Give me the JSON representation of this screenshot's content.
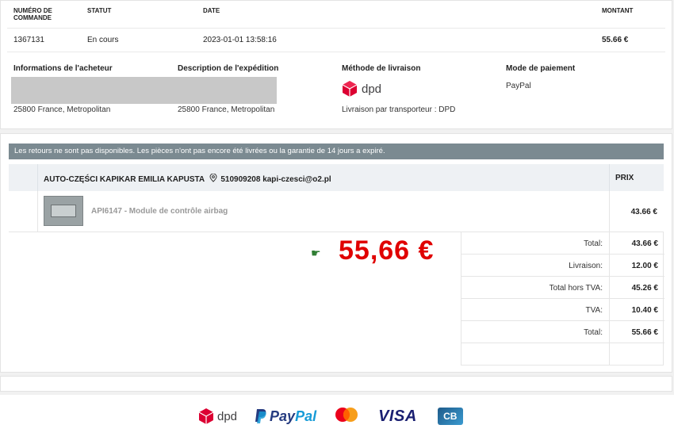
{
  "order": {
    "headers": {
      "number": "NUMÉRO DE COMMANDE",
      "status": "STATUT",
      "date": "DATE",
      "amount": "MONTANT"
    },
    "number": "1367131",
    "status": "En cours",
    "date": "2023-01-01 13:58:16",
    "amount": "55.66 €"
  },
  "buyer": {
    "title": "Informations de l'acheteur",
    "address": "25800 France, Metropolitan"
  },
  "shipping_desc": {
    "title": "Description de l'expédition",
    "address": "25800 France, Metropolitan"
  },
  "delivery": {
    "title": "Méthode de livraison",
    "logo_text": "dpd",
    "detail": "Livraison par transporteur : DPD"
  },
  "payment": {
    "title": "Mode de paiement",
    "method": "PayPal"
  },
  "notice": "Les retours ne sont pas disponibles. Les pièces n'ont pas encore été livrées ou la garantie de 14 jours a expiré.",
  "seller": {
    "name": "AUTO-CZĘŚCI KAPIKAR EMILIA KAPUSTA",
    "phone": "510909208",
    "email": "kapi-czesci@o2.pl",
    "price_header": "PRIX"
  },
  "item": {
    "label": "API6147 - Module de contrôle airbag",
    "price": "43.66 €"
  },
  "big_price": "55,66 €",
  "totals": [
    {
      "label": "Total:",
      "value": "43.66 €"
    },
    {
      "label": "Livraison:",
      "value": "12.00 €"
    },
    {
      "label": "Total hors TVA:",
      "value": "45.26 €"
    },
    {
      "label": "TVA:",
      "value": "10.40 €"
    },
    {
      "label": "Total:",
      "value": "55.66 €"
    }
  ],
  "footer_logos": {
    "dpd": "dpd",
    "paypal_pay": "Pay",
    "paypal_pal": "Pal",
    "visa": "VISA",
    "cb": "CB"
  },
  "colors": {
    "dpd_red": "#dc0032",
    "price_red": "#e00000",
    "notice_bg": "#7b8a91",
    "paypal_dark": "#253b80",
    "paypal_light": "#179bd7",
    "visa_blue": "#1a1f71",
    "cb_blue": "#2d6ea6"
  }
}
